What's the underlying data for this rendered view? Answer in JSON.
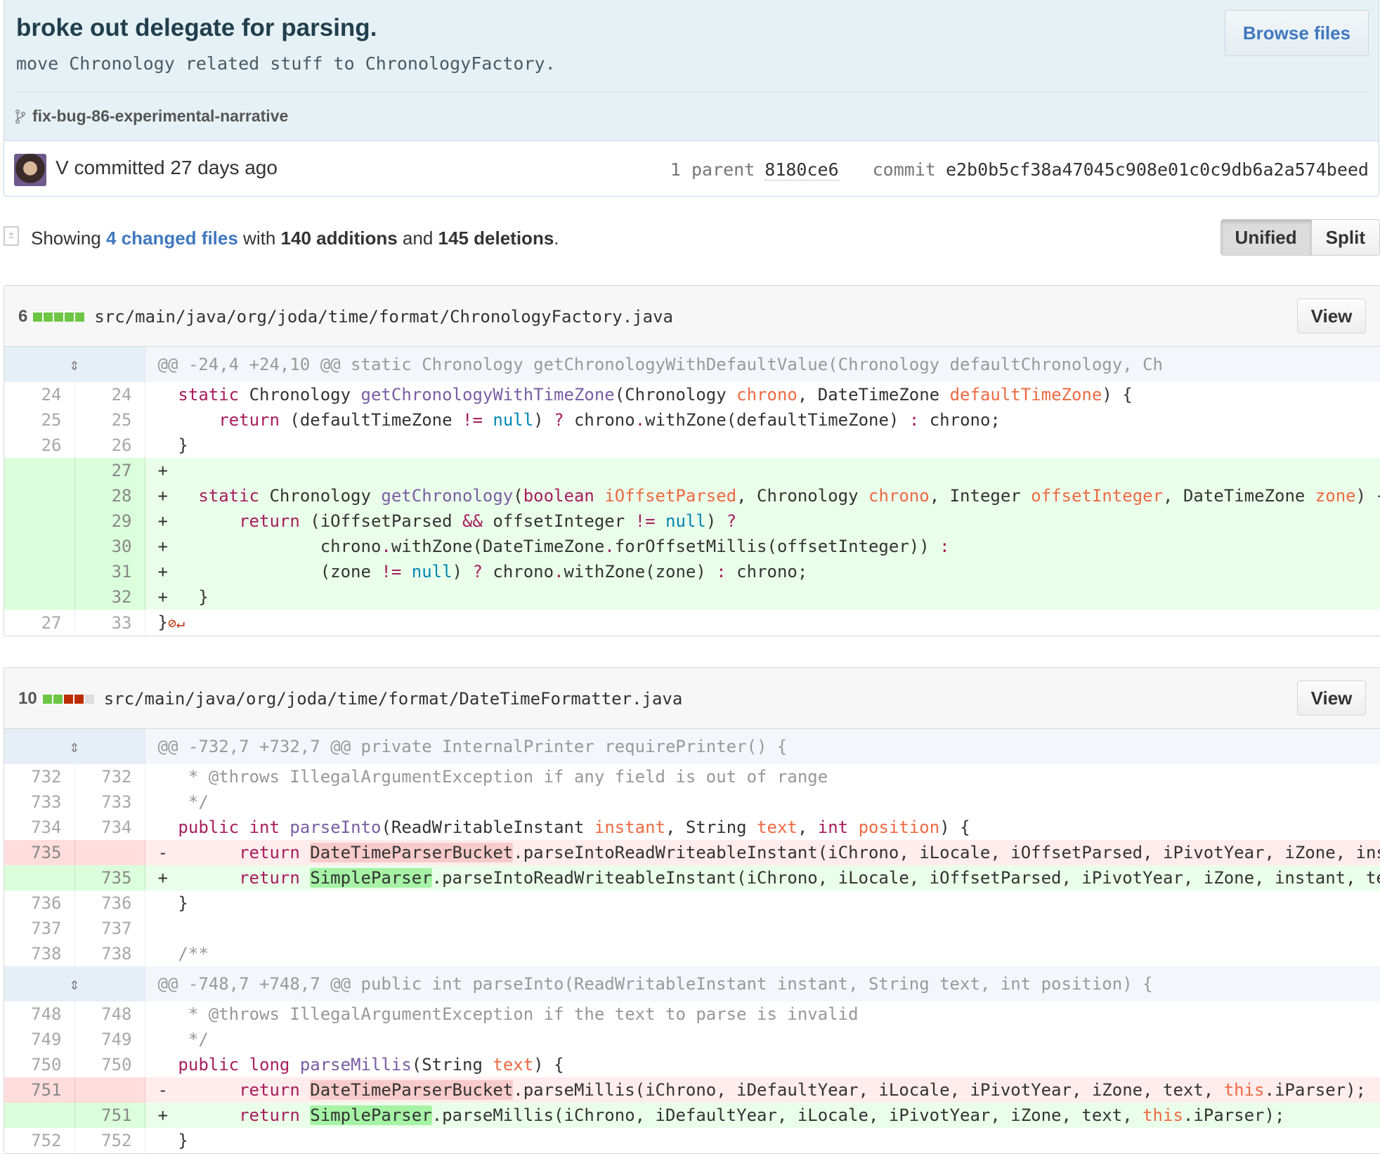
{
  "commit": {
    "title": "broke out delegate for parsing.",
    "description": "move Chronology related stuff to ChronologyFactory.",
    "browse_label": "Browse files",
    "branch": "fix-bug-86-experimental-narrative",
    "author_text": "V committed 27 days ago",
    "parent_label": "1 parent",
    "parent_sha": "8180ce6",
    "commit_label": "commit",
    "commit_sha": "e2b0b5cf38a47045c908e01c0c9db6a2a574beed"
  },
  "toolbar": {
    "showing": "Showing",
    "changed_files": "4 changed files",
    "with": "with",
    "additions": "140 additions",
    "and": "and",
    "deletions": "145 deletions",
    "period": ".",
    "unified": "Unified",
    "split": "Split"
  },
  "files": [
    {
      "count": "6",
      "path": "src/main/java/org/joda/time/format/ChronologyFactory.java",
      "view_label": "View",
      "hunk": "@@ -24,4 +24,10 @@ static Chronology getChronologyWithDefaultValue(Chronology defaultChronology, Ch"
    },
    {
      "count": "10",
      "path": "src/main/java/org/joda/time/format/DateTimeFormatter.java",
      "view_label": "View",
      "hunk1": "@@ -732,7 +732,7 @@ private InternalPrinter requirePrinter() {",
      "hunk2": "@@ -748,7 +748,7 @@ public int parseInto(ReadWritableInstant instant, String text, int position) {"
    }
  ],
  "colors": {
    "add": "#6cc644",
    "del": "#bd2c00",
    "link": "#4078c0"
  }
}
